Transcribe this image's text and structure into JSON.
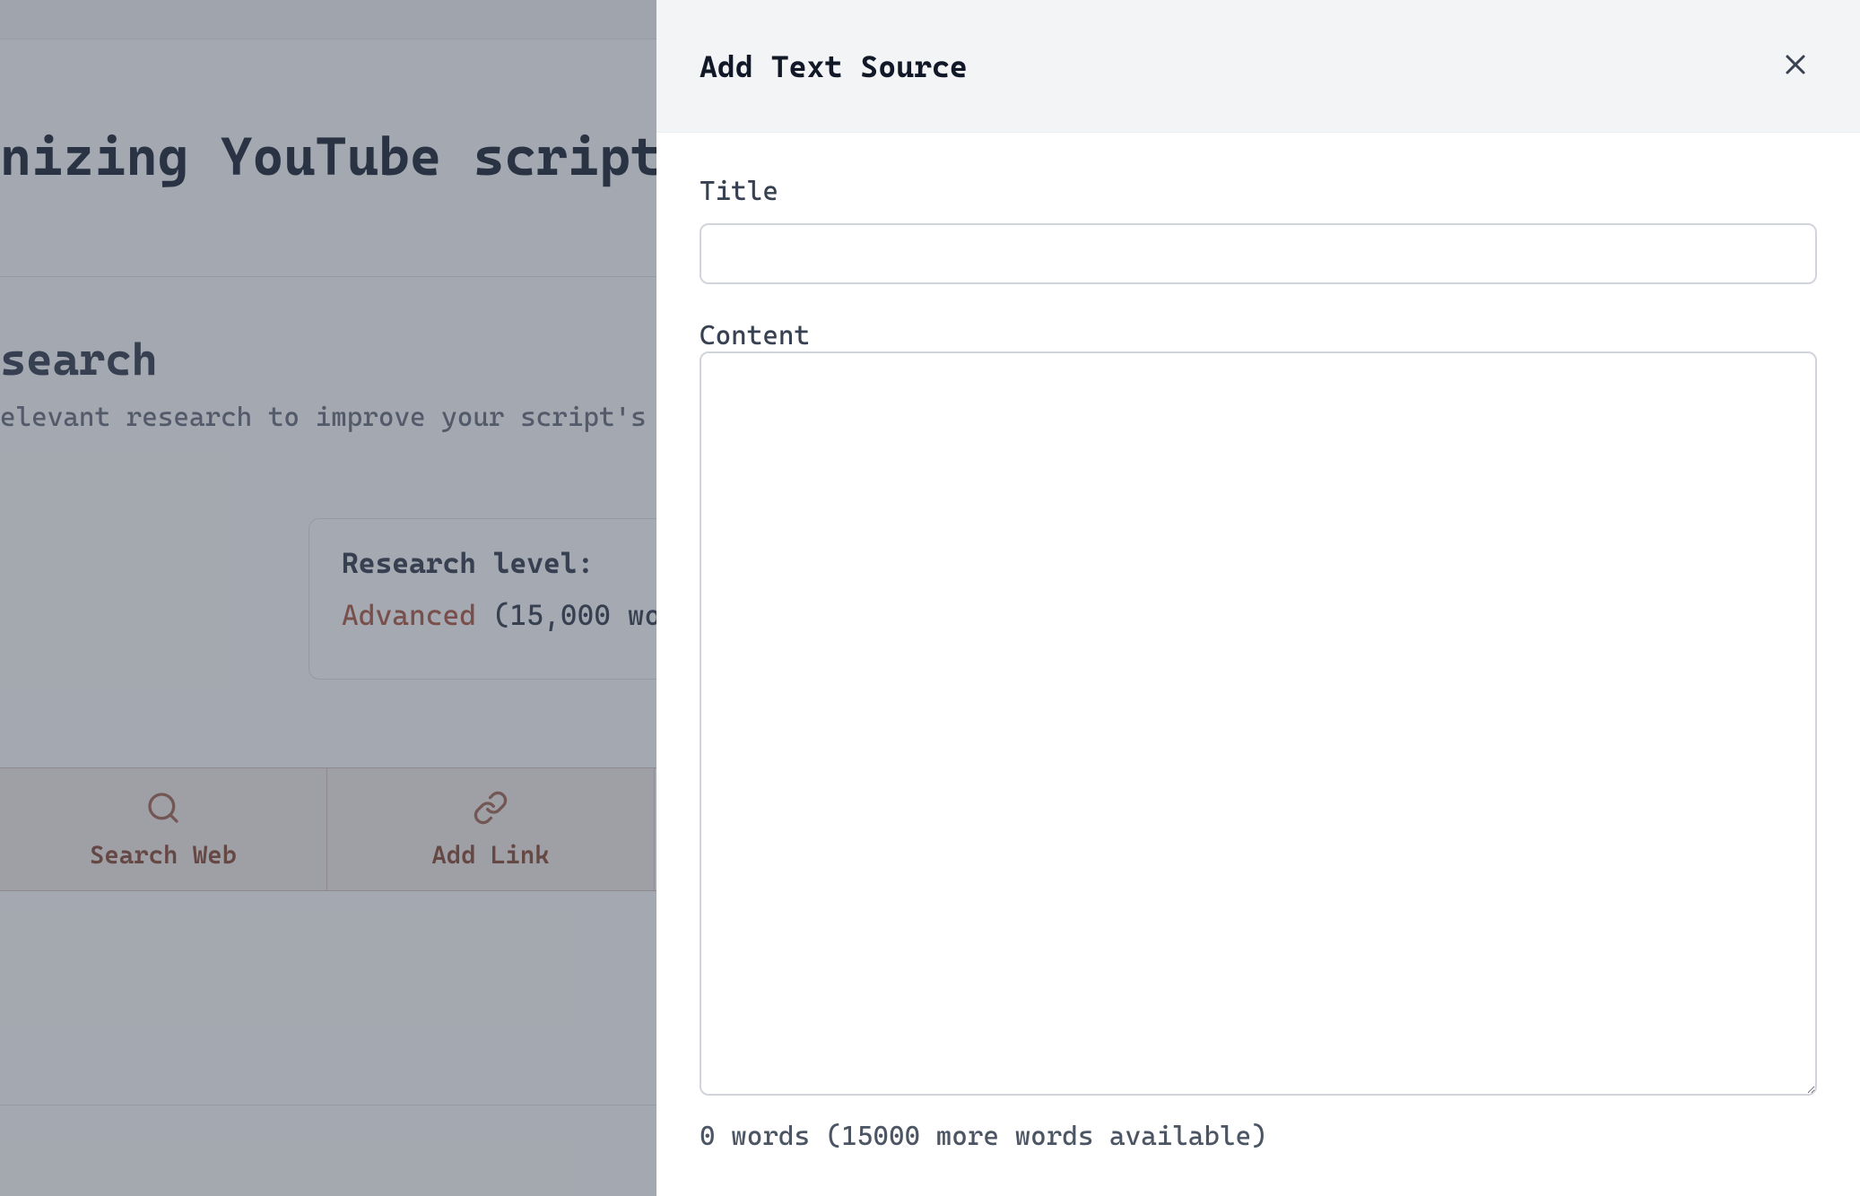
{
  "background": {
    "page_title_fragment": "nizing YouTube script",
    "section_title_fragment": "search",
    "section_desc_fragment": "elevant research to improve your script's ac",
    "research_level_label": "Research level:",
    "research_level_name": "Advanced",
    "research_level_detail": " (15,000 wo",
    "tabs": [
      {
        "label": "Search Web",
        "icon": "search"
      },
      {
        "label": "Add Link",
        "icon": "link"
      }
    ]
  },
  "panel": {
    "title": "Add Text Source",
    "title_label": "Title",
    "title_value": "",
    "content_label": "Content",
    "content_value": "",
    "word_count_text": "0 words (15000 more words available)"
  }
}
